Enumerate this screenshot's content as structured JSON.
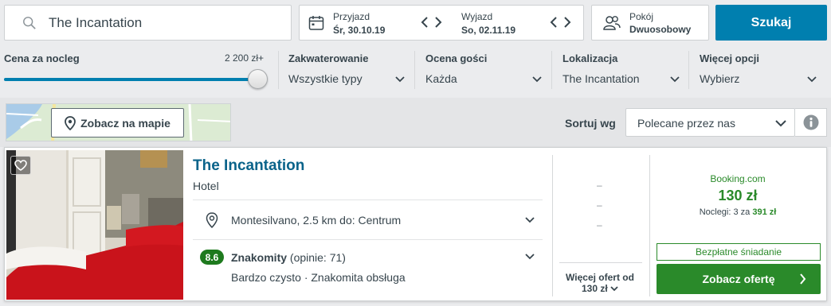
{
  "search": {
    "destination": "The Incantation",
    "checkin_label": "Przyjazd",
    "checkin_value": "Śr, 30.10.19",
    "checkout_label": "Wyjazd",
    "checkout_value": "So, 02.11.19",
    "room_label": "Pokój",
    "room_value": "Dwuosobowy",
    "search_button": "Szukaj"
  },
  "filters": {
    "price": {
      "title": "Cena za nocleg",
      "max": "2 200 zł+",
      "level": 1.0
    },
    "accommodation": {
      "title": "Zakwaterowanie",
      "value": "Wszystkie typy"
    },
    "rating": {
      "title": "Ocena gości",
      "value": "Każda"
    },
    "location": {
      "title": "Lokalizacja",
      "value": "The Incantation"
    },
    "more": {
      "title": "Więcej opcji",
      "value": "Wybierz"
    }
  },
  "map": {
    "button": "Zobacz na mapie"
  },
  "sort": {
    "label": "Sortuj wg",
    "value": "Polecane przez nas"
  },
  "hotel": {
    "name": "The Incantation",
    "type": "Hotel",
    "location": "Montesilvano, 2.5 km do: Centrum",
    "rating_score": "8.6",
    "rating_word": "Znakomity",
    "rating_count": "(opinie: 71)",
    "tags": "Bardzo czysto · Znakomita obsługa",
    "dash": "–",
    "more_offers_line1": "Więcej ofert od",
    "more_offers_line2": "130 zł",
    "provider": "Booking.com",
    "price": "130 zł",
    "nights_prefix": "Noclegi: 3 za",
    "nights_total": "391 zł",
    "breakfast": "Bezpłatne śniadanie",
    "deal_button": "Zobacz ofertę"
  },
  "icons": {
    "search": "search-icon",
    "calendar": "calendar-icon",
    "room": "users-icon",
    "pin": "map-pin-icon",
    "heart": "heart-icon",
    "info": "info-icon"
  },
  "colors": {
    "primary_blue": "#007faf",
    "hotel_name": "#0a638a",
    "deal_green": "#2a8a2a",
    "rating_badge": "#1e7a1e"
  }
}
